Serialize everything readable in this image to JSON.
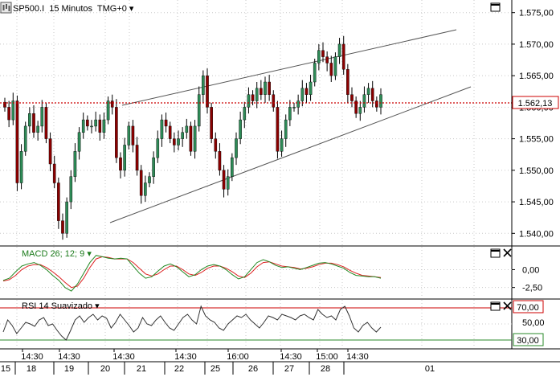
{
  "main_chart": {
    "symbol": "SP500.I",
    "interval": "15 Minutos",
    "timezone": "TMG+0",
    "dropdown_glyph": "▾",
    "price_axis_labels": [
      "1.575,00",
      "1.570,00",
      "1.565,00",
      "1.560,00",
      "1.555,00",
      "1.550,00",
      "1.545,00",
      "1.540,00"
    ],
    "last_price_label": "1.562,13",
    "last_price_value": 1562.13,
    "colors": {
      "up_candle": "#2e8b57",
      "down_candle": "#8b0000",
      "trend_line": "#555555",
      "price_marker": "#cc0000"
    }
  },
  "macd": {
    "label": "MACD 26; 12; 9",
    "dropdown_glyph": "▾",
    "axis_labels": [
      "0,00",
      "-2,50"
    ],
    "colors": {
      "macd": "#228822",
      "signal": "#dd2222",
      "label": "#1a7a1a"
    }
  },
  "rsi": {
    "label": "RSI 14 Suavizado",
    "dropdown_glyph": "▾",
    "axis_labels": [
      "50,00"
    ],
    "upper_level_label": "70,00",
    "lower_level_label": "30,00",
    "colors": {
      "upper": "#cc0000",
      "lower": "#2a8a2a",
      "line": "#333333"
    }
  },
  "time_axis": {
    "time_labels": [
      "14:30",
      "14:30",
      "14:30",
      "14:30",
      "16:00",
      "14:30",
      "15:00",
      "14:30"
    ],
    "date_labels": [
      "15",
      "18",
      "19",
      "20",
      "21",
      "22",
      "25",
      "26",
      "27",
      "28",
      "01"
    ]
  },
  "icons": {
    "window": "square-icon",
    "close": "close-icon"
  },
  "chart_data": [
    {
      "type": "line",
      "title": "SP500.I 15 Minutos TMG+0",
      "ylim": [
        1538,
        1577
      ],
      "y_ticks": [
        1540,
        1545,
        1550,
        1555,
        1560,
        1565,
        1570,
        1575
      ],
      "x_date_labels": [
        "15",
        "18",
        "19",
        "20",
        "21",
        "22",
        "25",
        "26",
        "27",
        "28",
        "01"
      ],
      "series": [
        {
          "name": "SP500.I",
          "values": [
            1560,
            1558,
            1561,
            1548,
            1553,
            1557,
            1559,
            1556,
            1557,
            1560,
            1555,
            1551,
            1548,
            1542,
            1540,
            1545,
            1549,
            1553,
            1556,
            1558,
            1557,
            1557,
            1558,
            1556,
            1558,
            1561,
            1560,
            1552,
            1550,
            1554,
            1557,
            1554,
            1550,
            1546,
            1548,
            1549,
            1552,
            1555,
            1558,
            1557,
            1555,
            1554,
            1555,
            1556,
            1557,
            1553,
            1557,
            1562,
            1565,
            1560,
            1555,
            1553,
            1550,
            1547,
            1549,
            1552,
            1555,
            1558,
            1560,
            1562,
            1561,
            1563,
            1562,
            1564,
            1562,
            1560,
            1553,
            1555,
            1558,
            1560,
            1560,
            1561,
            1563,
            1562,
            1564,
            1567,
            1569,
            1568,
            1567,
            1565,
            1568,
            1570,
            1566,
            1562,
            1561,
            1559,
            1560,
            1562,
            1563,
            1561,
            1560,
            1562
          ]
        }
      ],
      "annotations": [
        {
          "label": "1.562,13",
          "value": 1562.13
        }
      ]
    },
    {
      "type": "line",
      "title": "MACD 26; 12; 9",
      "ylim": [
        -4,
        3.2
      ],
      "y_ticks": [
        0,
        -2.5
      ],
      "series": [
        {
          "name": "MACD",
          "values": [
            -1.5,
            -1.2,
            -0.3,
            0.5,
            0.8,
            1,
            0.6,
            0,
            -0.8,
            -1.5,
            -2.5,
            -3,
            -2,
            -0.5,
            1,
            2,
            1.8,
            1.6,
            1.5,
            1.6,
            1.5,
            0.5,
            -0.5,
            -1.2,
            -1,
            -0.2,
            0.5,
            0.8,
            0.4,
            -0.3,
            -1,
            -0.7,
            0,
            0.5,
            0.7,
            0.5,
            0,
            -0.7,
            -1.3,
            -1,
            0,
            1,
            1.4,
            1.1,
            0.6,
            0.3,
            0.4,
            0.2,
            0,
            0.3,
            0.6,
            0.9,
            1,
            0.8,
            0.5,
            0.2,
            -0.4,
            -0.8,
            -0.9,
            -1,
            -1,
            -1.2
          ]
        },
        {
          "name": "Signal",
          "values": [
            -1.6,
            -1.4,
            -0.8,
            0,
            0.5,
            0.7,
            0.7,
            0.3,
            -0.3,
            -1,
            -1.8,
            -2.5,
            -2.3,
            -1.2,
            0.3,
            1.5,
            1.8,
            1.7,
            1.5,
            1.5,
            1.5,
            1,
            0.2,
            -0.6,
            -0.9,
            -0.6,
            0,
            0.5,
            0.5,
            0,
            -0.6,
            -0.8,
            -0.4,
            0.2,
            0.5,
            0.5,
            0.2,
            -0.3,
            -0.9,
            -1.1,
            -0.5,
            0.4,
            1,
            1.1,
            0.8,
            0.5,
            0.4,
            0.3,
            0.1,
            0.2,
            0.4,
            0.7,
            0.9,
            0.9,
            0.7,
            0.4,
            -0.1,
            -0.5,
            -0.8,
            -0.9,
            -1,
            -1.1
          ]
        }
      ]
    },
    {
      "type": "line",
      "title": "RSI 14 Suavizado",
      "ylim": [
        20,
        80
      ],
      "y_ticks": [
        30,
        50,
        70
      ],
      "series": [
        {
          "name": "RSI 14 Suavizado",
          "values": [
            40,
            55,
            48,
            38,
            45,
            52,
            50,
            47,
            55,
            58,
            48,
            50,
            42,
            35,
            30,
            42,
            55,
            60,
            52,
            58,
            62,
            55,
            60,
            57,
            45,
            52,
            62,
            55,
            48,
            40,
            45,
            58,
            50,
            48,
            55,
            60,
            52,
            45,
            42,
            50,
            58,
            62,
            55,
            50,
            72,
            60,
            55,
            52,
            45,
            42,
            50,
            55,
            60,
            58,
            62,
            55,
            50,
            45,
            52,
            60,
            58,
            55,
            62,
            60,
            58,
            55,
            60,
            62,
            58,
            55,
            68,
            62,
            58,
            60,
            55,
            68,
            72,
            60,
            45,
            40,
            48,
            52,
            45,
            40,
            46
          ]
        }
      ],
      "annotations": [
        {
          "label": "70,00",
          "value": 70
        },
        {
          "label": "30,00",
          "value": 30
        }
      ]
    }
  ]
}
